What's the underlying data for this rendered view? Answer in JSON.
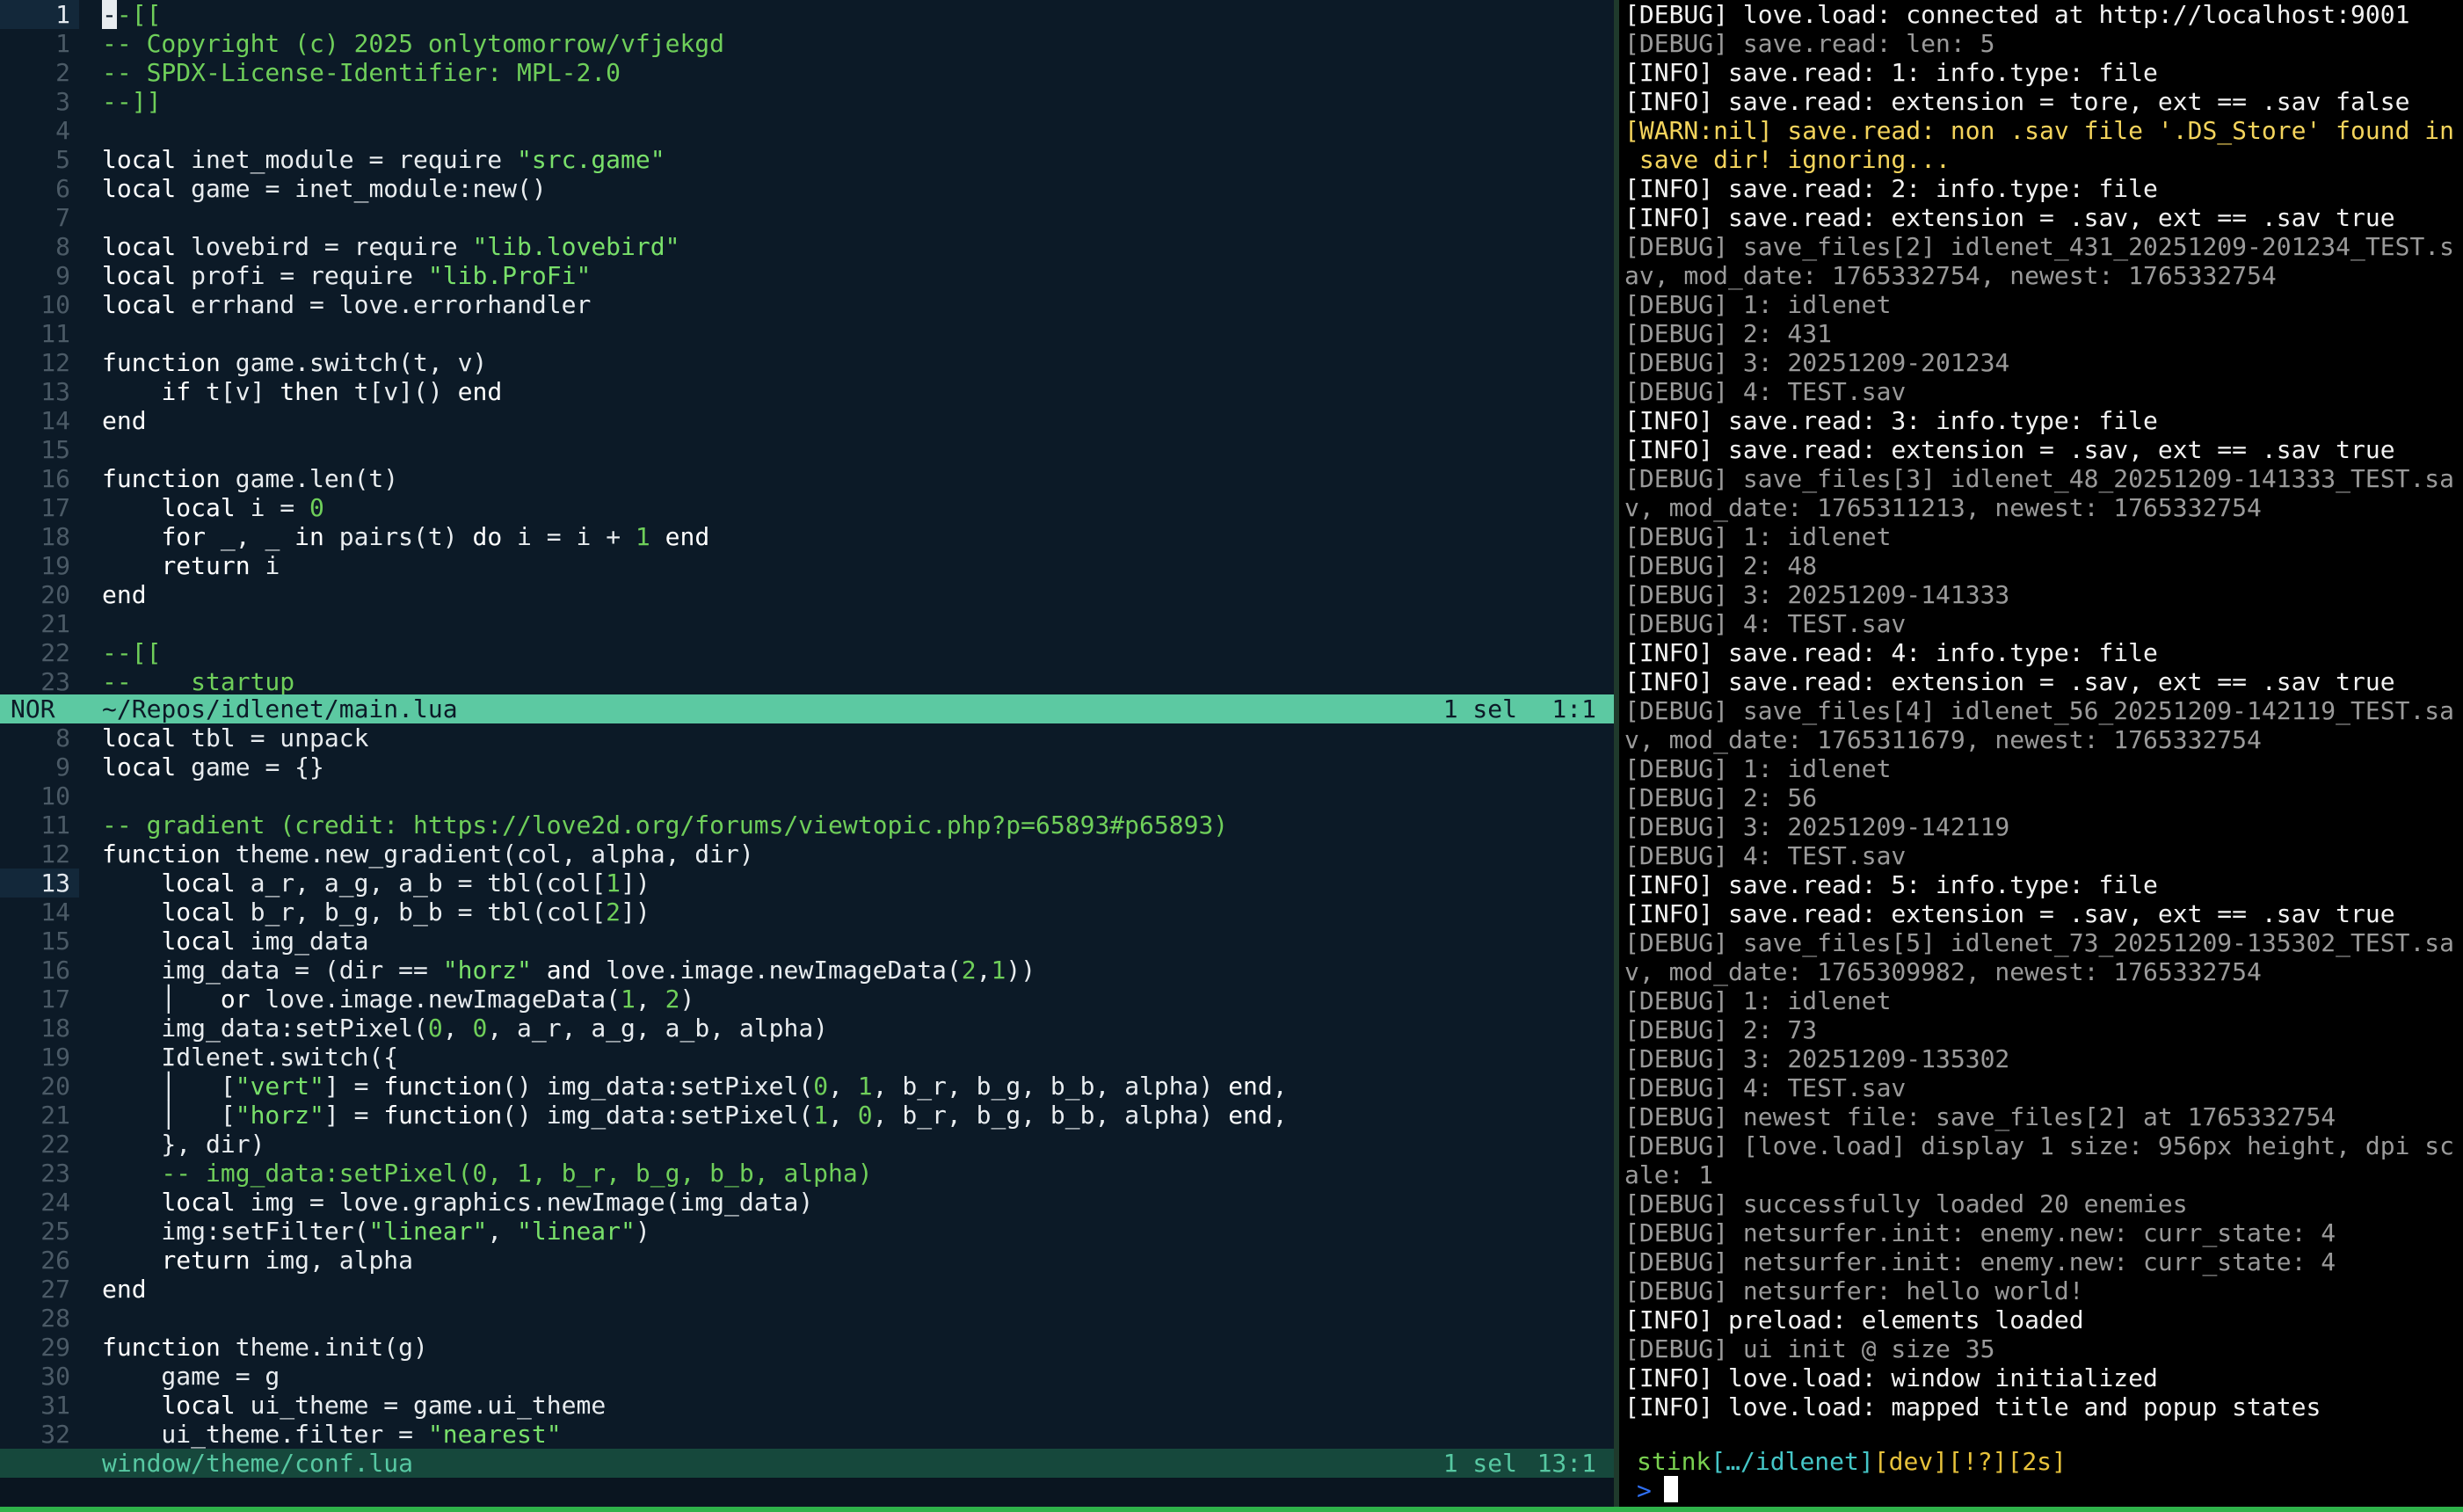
{
  "top_pane": {
    "lines": [
      {
        "n": "1",
        "cursor_char": "-",
        "rest": "-[[",
        "current": true
      },
      {
        "n": "1",
        "text": "-- Copyright (c) 2025 onlytomorrow/vfjekgd",
        "cls": "comment"
      },
      {
        "n": "2",
        "text": "-- SPDX-License-Identifier: MPL-2.0",
        "cls": "comment"
      },
      {
        "n": "3",
        "text": "--]]",
        "cls": "comment"
      },
      {
        "n": "4",
        "text": ""
      },
      {
        "n": "5",
        "text": "local inet_module = require \"src.game\""
      },
      {
        "n": "6",
        "text": "local game = inet_module:new()"
      },
      {
        "n": "7",
        "text": ""
      },
      {
        "n": "8",
        "text": "local lovebird = require \"lib.lovebird\""
      },
      {
        "n": "9",
        "text": "local profi = require \"lib.ProFi\""
      },
      {
        "n": "10",
        "text": "local errhand = love.errorhandler"
      },
      {
        "n": "11",
        "text": ""
      },
      {
        "n": "12",
        "text": "function game.switch(t, v)"
      },
      {
        "n": "13",
        "text": "    if t[v] then t[v]() end"
      },
      {
        "n": "14",
        "text": "end"
      },
      {
        "n": "15",
        "text": ""
      },
      {
        "n": "16",
        "text": "function game.len(t)"
      },
      {
        "n": "17",
        "text": "    local i = 0"
      },
      {
        "n": "18",
        "text": "    for _, _ in pairs(t) do i = i + 1 end"
      },
      {
        "n": "19",
        "text": "    return i"
      },
      {
        "n": "20",
        "text": "end"
      },
      {
        "n": "21",
        "text": ""
      },
      {
        "n": "22",
        "text": "--[[",
        "cls": "comment"
      },
      {
        "n": "23",
        "text": "--    startup",
        "cls": "comment"
      }
    ]
  },
  "top_status": {
    "mode": "NOR",
    "path": "~/Repos/idlenet/main.lua",
    "sel": "1 sel",
    "pos": "1:1"
  },
  "bottom_pane": {
    "lines": [
      {
        "n": "8",
        "text": "local tbl = unpack"
      },
      {
        "n": "9",
        "text": "local game = {}"
      },
      {
        "n": "10",
        "text": ""
      },
      {
        "n": "11",
        "text": "-- gradient (credit: https://love2d.org/forums/viewtopic.php?p=65893#p65893)",
        "cls": "comment"
      },
      {
        "n": "12",
        "text": "function theme.new_gradient(col, alpha, dir)"
      },
      {
        "n": "13",
        "text": "    local a_r, a_g, a_b = tbl(col[1])",
        "current": true
      },
      {
        "n": "14",
        "text": "    local b_r, b_g, b_b = tbl(col[2])"
      },
      {
        "n": "15",
        "text": "    local img_data"
      },
      {
        "n": "16",
        "text": "    img_data = (dir == \"horz\" and love.image.newImageData(2,1))"
      },
      {
        "n": "17",
        "text": "    │   or love.image.newImageData(1, 2)"
      },
      {
        "n": "18",
        "text": "    img_data:setPixel(0, 0, a_r, a_g, a_b, alpha)"
      },
      {
        "n": "19",
        "text": "    Idlenet.switch({"
      },
      {
        "n": "20",
        "text": "    │   [\"vert\"] = function() img_data:setPixel(0, 1, b_r, b_g, b_b, alpha) end,"
      },
      {
        "n": "21",
        "text": "    │   [\"horz\"] = function() img_data:setPixel(1, 0, b_r, b_g, b_b, alpha) end,"
      },
      {
        "n": "22",
        "text": "    }, dir)"
      },
      {
        "n": "23",
        "text": "    -- img_data:setPixel(0, 1, b_r, b_g, b_b, alpha)",
        "cls": "comment"
      },
      {
        "n": "24",
        "text": "    local img = love.graphics.newImage(img_data)"
      },
      {
        "n": "25",
        "text": "    img:setFilter(\"linear\", \"linear\")"
      },
      {
        "n": "26",
        "text": "    return img, alpha"
      },
      {
        "n": "27",
        "text": "end"
      },
      {
        "n": "28",
        "text": ""
      },
      {
        "n": "29",
        "text": "function theme.init(g)"
      },
      {
        "n": "30",
        "text": "    game = g"
      },
      {
        "n": "31",
        "text": "    local ui_theme = game.ui_theme"
      },
      {
        "n": "32",
        "text": "    ui_theme.filter = \"nearest\""
      }
    ]
  },
  "bottom_status": {
    "path": "window/theme/conf.lua",
    "sel": "1 sel",
    "pos": "13:1"
  },
  "terminal": {
    "lines": [
      {
        "t": "[DEBUG] love.load: connected at http://localhost:9001",
        "k": "info"
      },
      {
        "t": "[DEBUG] save.read: len: 5",
        "k": "debug"
      },
      {
        "t": "[INFO] save.read: 1: info.type: file",
        "k": "info"
      },
      {
        "t": "[INFO] save.read: extension = tore, ext == .sav false",
        "k": "info"
      },
      {
        "t": "[WARN:nil] save.read: non .sav file '.DS_Store' found in",
        "k": "warn"
      },
      {
        "t": " save dir! ignoring...",
        "k": "warn"
      },
      {
        "t": "[INFO] save.read: 2: info.type: file",
        "k": "info"
      },
      {
        "t": "[INFO] save.read: extension = .sav, ext == .sav true",
        "k": "info"
      },
      {
        "t": "[DEBUG] save_files[2] idlenet_431_20251209-201234_TEST.s",
        "k": "debug"
      },
      {
        "t": "av, mod_date: 1765332754, newest: 1765332754",
        "k": "debug"
      },
      {
        "t": "[DEBUG] 1: idlenet",
        "k": "debug"
      },
      {
        "t": "[DEBUG] 2: 431",
        "k": "debug"
      },
      {
        "t": "[DEBUG] 3: 20251209-201234",
        "k": "debug"
      },
      {
        "t": "[DEBUG] 4: TEST.sav",
        "k": "debug"
      },
      {
        "t": "[INFO] save.read: 3: info.type: file",
        "k": "info"
      },
      {
        "t": "[INFO] save.read: extension = .sav, ext == .sav true",
        "k": "info"
      },
      {
        "t": "[DEBUG] save_files[3] idlenet_48_20251209-141333_TEST.sa",
        "k": "debug"
      },
      {
        "t": "v, mod_date: 1765311213, newest: 1765332754",
        "k": "debug"
      },
      {
        "t": "[DEBUG] 1: idlenet",
        "k": "debug"
      },
      {
        "t": "[DEBUG] 2: 48",
        "k": "debug"
      },
      {
        "t": "[DEBUG] 3: 20251209-141333",
        "k": "debug"
      },
      {
        "t": "[DEBUG] 4: TEST.sav",
        "k": "debug"
      },
      {
        "t": "[INFO] save.read: 4: info.type: file",
        "k": "info"
      },
      {
        "t": "[INFO] save.read: extension = .sav, ext == .sav true",
        "k": "info"
      },
      {
        "t": "[DEBUG] save_files[4] idlenet_56_20251209-142119_TEST.sa",
        "k": "debug"
      },
      {
        "t": "v, mod_date: 1765311679, newest: 1765332754",
        "k": "debug"
      },
      {
        "t": "[DEBUG] 1: idlenet",
        "k": "debug"
      },
      {
        "t": "[DEBUG] 2: 56",
        "k": "debug"
      },
      {
        "t": "[DEBUG] 3: 20251209-142119",
        "k": "debug"
      },
      {
        "t": "[DEBUG] 4: TEST.sav",
        "k": "debug"
      },
      {
        "t": "[INFO] save.read: 5: info.type: file",
        "k": "info"
      },
      {
        "t": "[INFO] save.read: extension = .sav, ext == .sav true",
        "k": "info"
      },
      {
        "t": "[DEBUG] save_files[5] idlenet_73_20251209-135302_TEST.sa",
        "k": "debug"
      },
      {
        "t": "v, mod_date: 1765309982, newest: 1765332754",
        "k": "debug"
      },
      {
        "t": "[DEBUG] 1: idlenet",
        "k": "debug"
      },
      {
        "t": "[DEBUG] 2: 73",
        "k": "debug"
      },
      {
        "t": "[DEBUG] 3: 20251209-135302",
        "k": "debug"
      },
      {
        "t": "[DEBUG] 4: TEST.sav",
        "k": "debug"
      },
      {
        "t": "[DEBUG] newest file: save_files[2] at 1765332754",
        "k": "debug"
      },
      {
        "t": "[DEBUG] [love.load] display 1 size: 956px height, dpi sc",
        "k": "debug"
      },
      {
        "t": "ale: 1",
        "k": "debug"
      },
      {
        "t": "[DEBUG] successfully loaded 20 enemies",
        "k": "debug"
      },
      {
        "t": "[DEBUG] netsurfer.init: enemy.new: curr_state: 4",
        "k": "debug"
      },
      {
        "t": "[DEBUG] netsurfer.init: enemy.new: curr_state: 4",
        "k": "debug"
      },
      {
        "t": "[DEBUG] netsurfer: hello world!",
        "k": "debug"
      },
      {
        "t": "[INFO] preload: elements loaded",
        "k": "info"
      },
      {
        "t": "[DEBUG] ui init @ size 35",
        "k": "debug"
      },
      {
        "t": "[INFO] love.load: window initialized",
        "k": "info"
      },
      {
        "t": "[INFO] love.load: mapped title and popup states",
        "k": "info"
      }
    ],
    "prompt": {
      "apple": "",
      "user": "stink",
      "path": "[…/idlenet]",
      "branch": "[dev]",
      "git_status": "[!?]",
      "duration": "[2s]",
      "arrow": ">"
    }
  },
  "colors": {
    "editor_bg": "#0c1a27",
    "status_active": "#5cc9a2",
    "status_inactive": "#16483c",
    "comment": "#6fcf5a",
    "string": "#79e06a",
    "keyword": "#ffffff",
    "number": "#6fcf5a",
    "warn": "#f4d45c"
  }
}
